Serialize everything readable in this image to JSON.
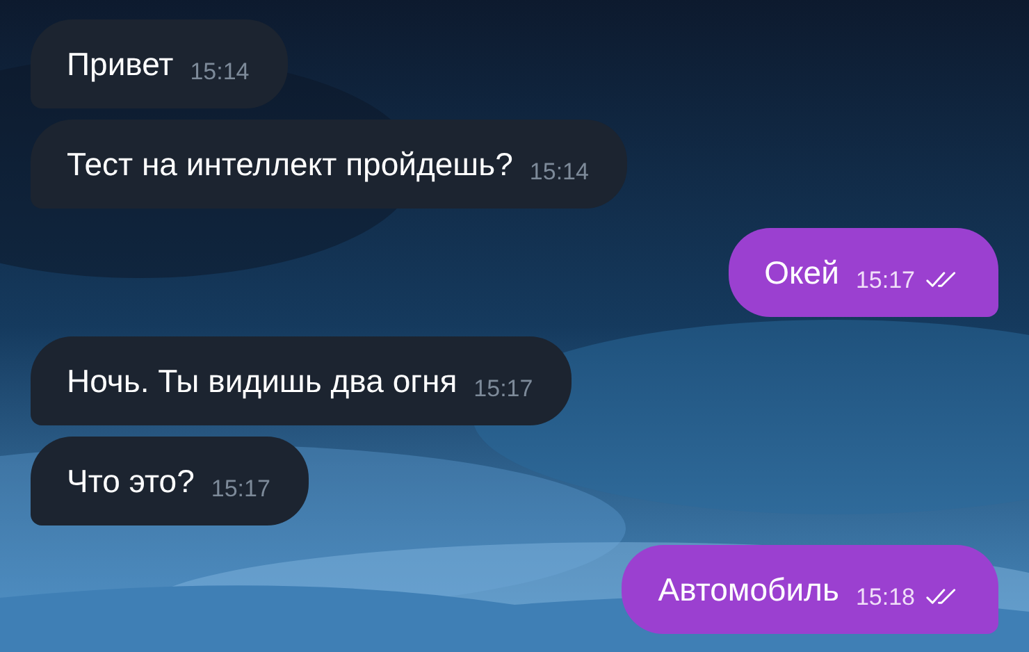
{
  "messages": [
    {
      "kind": "incoming",
      "text": "Привет",
      "time": "15:14"
    },
    {
      "kind": "incoming",
      "text": "Тест на интеллект пройдешь?",
      "time": "15:14"
    },
    {
      "kind": "outgoing",
      "text": "Окей",
      "time": "15:17",
      "read": true
    },
    {
      "kind": "incoming",
      "text": "Ночь. Ты видишь два огня",
      "time": "15:17"
    },
    {
      "kind": "incoming",
      "text": "Что это?",
      "time": "15:17"
    },
    {
      "kind": "outgoing",
      "text": "Автомобиль",
      "time": "15:18",
      "read": true
    }
  ]
}
